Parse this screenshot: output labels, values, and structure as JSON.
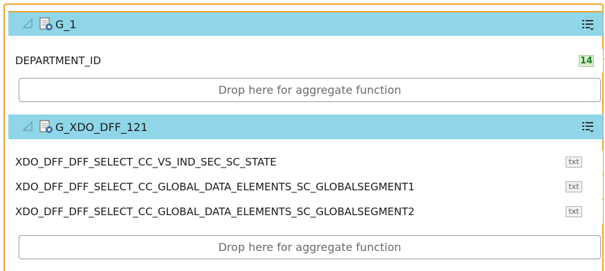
{
  "groups": [
    {
      "title": "G_1",
      "fields": [
        {
          "label": "DEPARTMENT_ID",
          "type_badge": "14",
          "type_kind": "number-icon"
        }
      ],
      "drop_zone": "Drop here for aggregate function"
    },
    {
      "title": "G_XDO_DFF_121",
      "fields": [
        {
          "label": "XDO_DFF_DFF_SELECT_CC_VS_IND_SEC_SC_STATE",
          "type_badge": "txt"
        },
        {
          "label": "XDO_DFF_DFF_SELECT_CC_GLOBAL_DATA_ELEMENTS_SC_GLOBALSEGMENT1",
          "type_badge": "txt"
        },
        {
          "label": "XDO_DFF_DFF_SELECT_CC_GLOBAL_DATA_ELEMENTS_SC_GLOBALSEGMENT2",
          "type_badge": "txt"
        }
      ],
      "drop_zone": "Drop here for aggregate function"
    }
  ],
  "colors": {
    "header_bg": "#8fd6e8",
    "selection_border": "#f0a030",
    "number_badge": "#208020"
  }
}
